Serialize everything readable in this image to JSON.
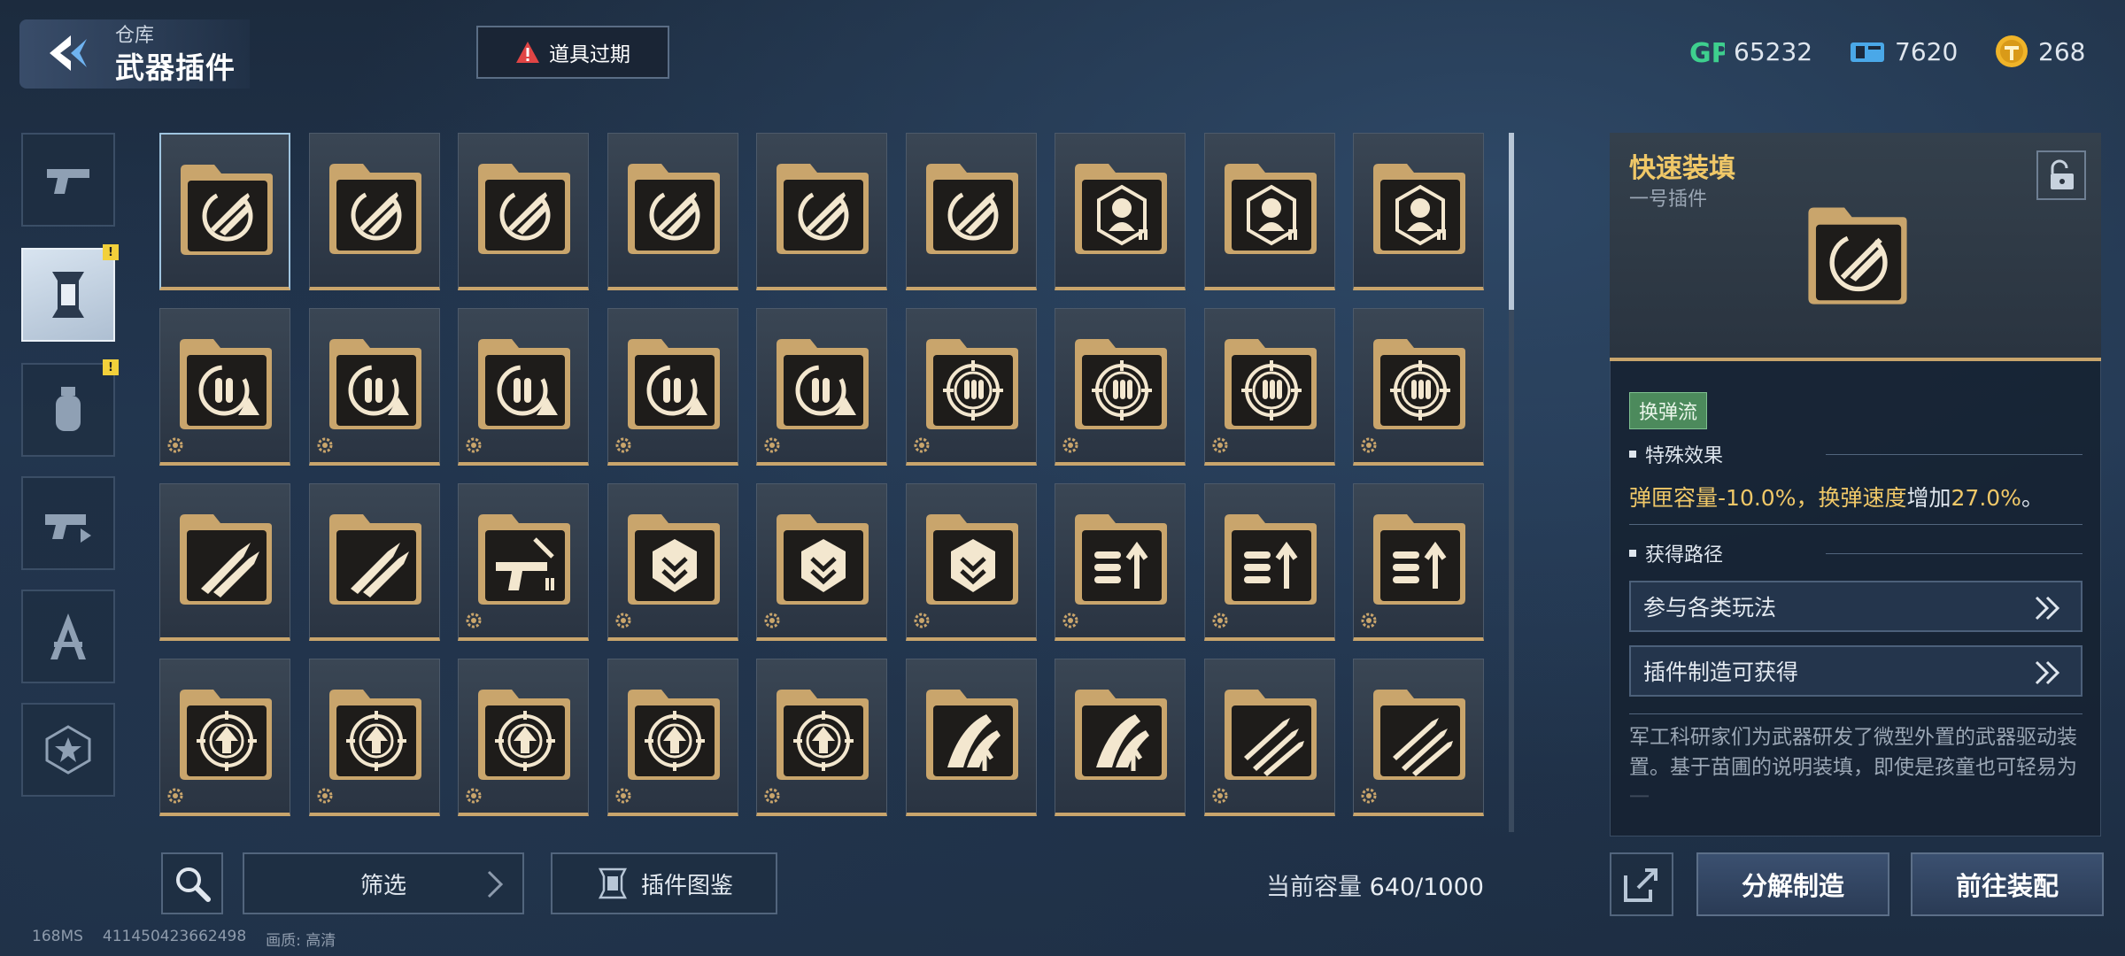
{
  "header": {
    "parent": "仓库",
    "title": "武器插件",
    "expired_label": "道具过期"
  },
  "currencies": [
    {
      "name": "gp-icon",
      "value": "65232",
      "color": "#3ecf8e"
    },
    {
      "name": "ticket-icon",
      "value": "7620",
      "color": "#4aa8e8"
    },
    {
      "name": "coin-icon",
      "value": "268",
      "color": "#f0b429"
    }
  ],
  "categories": [
    {
      "icon": "pistol-icon",
      "active": false,
      "badge": false
    },
    {
      "icon": "plugin-icon",
      "active": true,
      "badge": true
    },
    {
      "icon": "grenade-icon",
      "active": false,
      "badge": true
    },
    {
      "icon": "weapon-mod-icon",
      "active": false,
      "badge": false
    },
    {
      "icon": "blueprint-icon",
      "active": false,
      "badge": false
    },
    {
      "icon": "star-badge-icon",
      "active": false,
      "badge": false
    }
  ],
  "badge_mark": "!",
  "grid": {
    "rows": [
      [
        "reload-rocket-icon",
        "reload-rocket-icon",
        "reload-rocket-icon",
        "reload-rocket-icon",
        "reload-rocket-icon",
        "reload-rocket-icon",
        "headshot-target-icon",
        "headshot-target-icon",
        "headshot-target-icon"
      ],
      [
        "ammo-warning-icon",
        "ammo-warning-icon",
        "ammo-warning-icon",
        "ammo-warning-icon",
        "ammo-warning-icon",
        "crosshair-ammo-icon",
        "crosshair-ammo-icon",
        "crosshair-ammo-icon",
        "crosshair-ammo-icon"
      ],
      [
        "twin-rocket-icon",
        "twin-rocket-icon",
        "gun-upgrade-icon",
        "shield-chevron-icon",
        "shield-chevron-icon",
        "shield-chevron-icon",
        "ammo-up-icon",
        "ammo-up-icon",
        "ammo-up-icon"
      ],
      [
        "target-up-icon",
        "target-up-icon",
        "target-up-icon",
        "target-up-icon",
        "target-up-icon",
        "blade-up-icon",
        "blade-up-icon",
        "triple-missile-icon",
        "triple-missile-icon"
      ]
    ],
    "gear_cells": [
      [
        false,
        false,
        false,
        false,
        false,
        false,
        false,
        false,
        false
      ],
      [
        true,
        true,
        true,
        true,
        true,
        true,
        true,
        true,
        true
      ],
      [
        false,
        false,
        true,
        true,
        true,
        true,
        true,
        true,
        true
      ],
      [
        true,
        true,
        true,
        true,
        true,
        false,
        false,
        true,
        true
      ]
    ],
    "selected": [
      0,
      0
    ]
  },
  "bottom": {
    "filter_label": "筛选",
    "codex_label": "插件图鉴",
    "capacity_label": "当前容量",
    "capacity_value": "640/1000",
    "debug_ms": "168MS",
    "debug_id": "411450423662498",
    "debug_quality": "画质: 高清"
  },
  "detail": {
    "name": "快速装填",
    "slot": "一号插件",
    "tag": "换弹流",
    "effect_title": "特殊效果",
    "effect": {
      "part1": "弹匣容量",
      "val1": "-10.0%",
      "sep": "，",
      "part2": "换弹速度",
      "verb": "增加",
      "val2": "27.0%",
      "end": "。"
    },
    "source_title": "获得路径",
    "sources": [
      "参与各类玩法",
      "插件制造可获得"
    ],
    "description": "军工科研家们为武器研发了微型外置的武器驱动装置。基于苗圃的说明装填，即使是孩童也可轻易为一"
  },
  "actions": {
    "dismantle": "分解制造",
    "equip": "前往装配"
  },
  "colors": {
    "gold": "#c9a56c",
    "highlight": "#f0c868",
    "tag_green": "#4c8a5c"
  }
}
